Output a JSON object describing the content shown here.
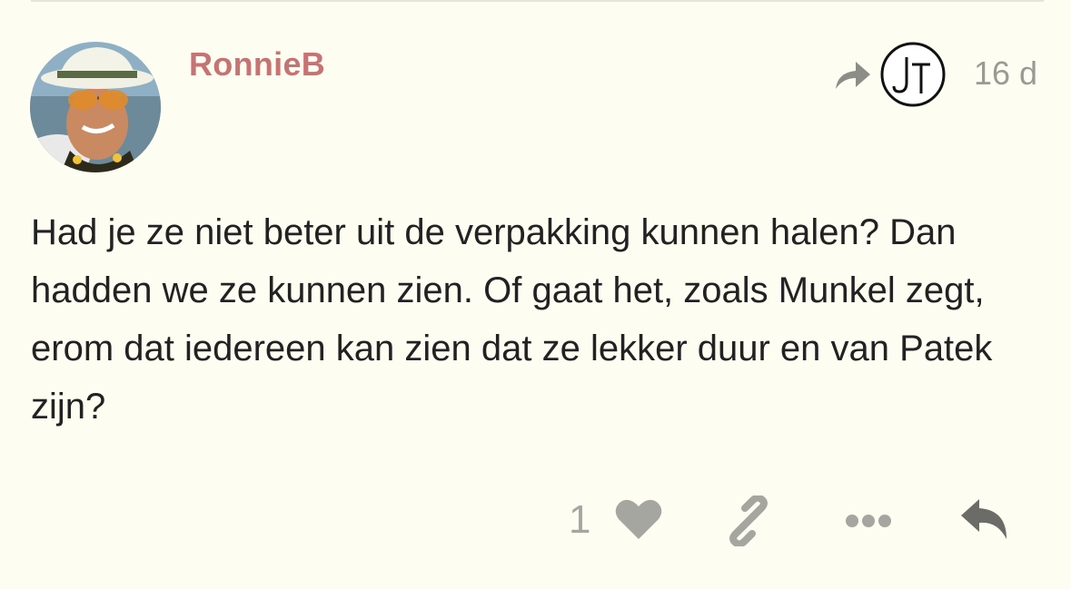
{
  "post": {
    "username": "RonnieB",
    "avatar_icon": "user-avatar-photo",
    "reply_to_icon": "reply-to-arrow-icon",
    "reply_to_user_initials": "JT",
    "date": "16 d",
    "body": "Had je ze niet beter uit de verpakking kunnen halen? Dan hadden we ze kunnen zien. Of gaat het, zoals Munkel zegt, erom dat iedereen kan zien dat ze lekker duur en van Patek zijn?"
  },
  "actions": {
    "like_count": "1",
    "icons": [
      "heart-icon",
      "link-icon",
      "more-icon",
      "reply-icon"
    ]
  },
  "colors": {
    "background": "#fdfdf1",
    "username": "#c77373",
    "muted": "#a6a6a0",
    "text": "#222222"
  }
}
